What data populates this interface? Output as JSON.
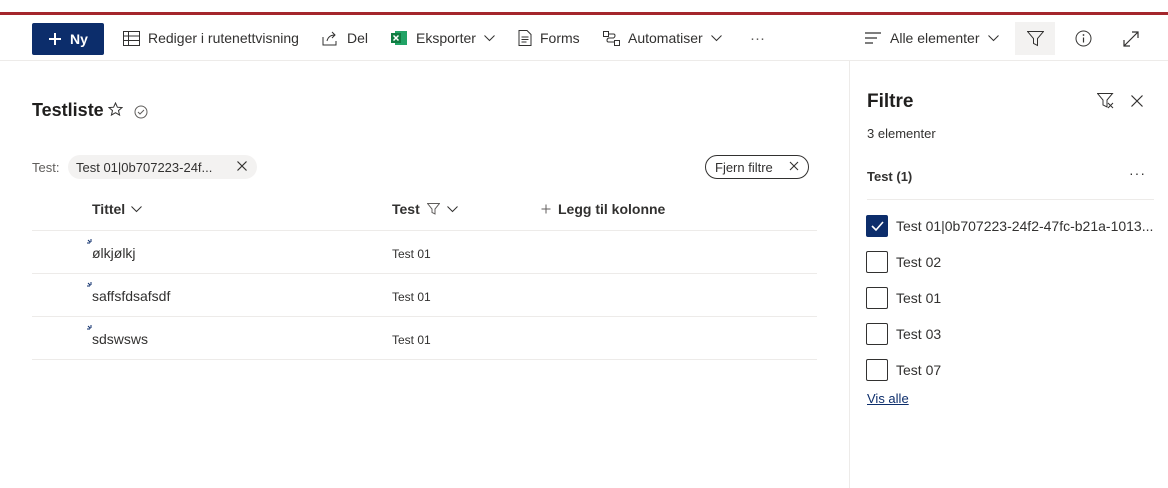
{
  "toolbar": {
    "new_label": "Ny",
    "grid_edit_label": "Rediger i rutenettvisning",
    "share_label": "Del",
    "export_label": "Eksporter",
    "forms_label": "Forms",
    "automate_label": "Automatiser",
    "more_label": "···",
    "view_label": "Alle elementer"
  },
  "list": {
    "title": "Testliste",
    "filter_pill_label": "Test:",
    "filter_pill_value": "Test 01|0b707223-24f...",
    "clear_filters_label": "Fjern filtre",
    "columns": {
      "title": "Tittel",
      "test": "Test",
      "add_column": "Legg til kolonne"
    },
    "rows": [
      {
        "title": "ølkjølkj",
        "test": "Test 01"
      },
      {
        "title": "saffsfdsafsdf",
        "test": "Test 01"
      },
      {
        "title": "sdswsws",
        "test": "Test 01"
      }
    ]
  },
  "filter_pane": {
    "title": "Filtre",
    "count": "3 elementer",
    "section_label": "Test (1)",
    "more_label": "···",
    "options": [
      {
        "label": "Test 01|0b707223-24f2-47fc-b21a-1013...",
        "checked": true
      },
      {
        "label": "Test 02",
        "checked": false
      },
      {
        "label": "Test 01",
        "checked": false
      },
      {
        "label": "Test 03",
        "checked": false
      },
      {
        "label": "Test 07",
        "checked": false
      }
    ],
    "see_all_label": "Vis alle"
  },
  "colors": {
    "brand": "#0c2d6b",
    "top_rule": "#a4262c",
    "excel_green": "#107c41"
  }
}
